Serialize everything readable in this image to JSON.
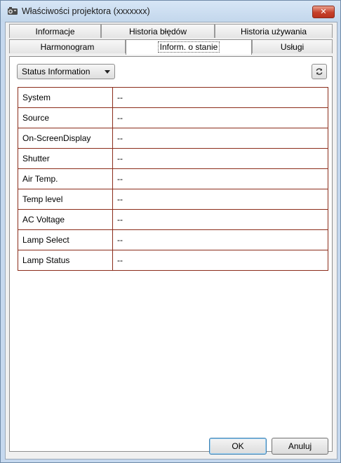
{
  "window": {
    "title": "Właściwości projektora (xxxxxxx)",
    "close_label": "✕",
    "accent_close": "#c6402b"
  },
  "tabs": {
    "row1": [
      {
        "label": "Informacje"
      },
      {
        "label": "Historia błędów"
      },
      {
        "label": "Historia używania"
      }
    ],
    "row2": [
      {
        "label": "Harmonogram"
      },
      {
        "label": "Inform. o stanie",
        "active": true
      },
      {
        "label": "Usługi"
      }
    ]
  },
  "toolbar": {
    "dropdown_value": "Status Information",
    "refresh_icon": "refresh-icon"
  },
  "status_table": {
    "rows": [
      {
        "key": "System",
        "value": "--"
      },
      {
        "key": "Source",
        "value": "--"
      },
      {
        "key": "On-ScreenDisplay",
        "value": "--"
      },
      {
        "key": "Shutter",
        "value": "--"
      },
      {
        "key": "Air Temp.",
        "value": "--"
      },
      {
        "key": "Temp level",
        "value": "--"
      },
      {
        "key": "AC Voltage",
        "value": "--"
      },
      {
        "key": "Lamp Select",
        "value": "--"
      },
      {
        "key": "Lamp Status",
        "value": "--"
      }
    ]
  },
  "buttons": {
    "ok": "OK",
    "cancel": "Anuluj"
  }
}
